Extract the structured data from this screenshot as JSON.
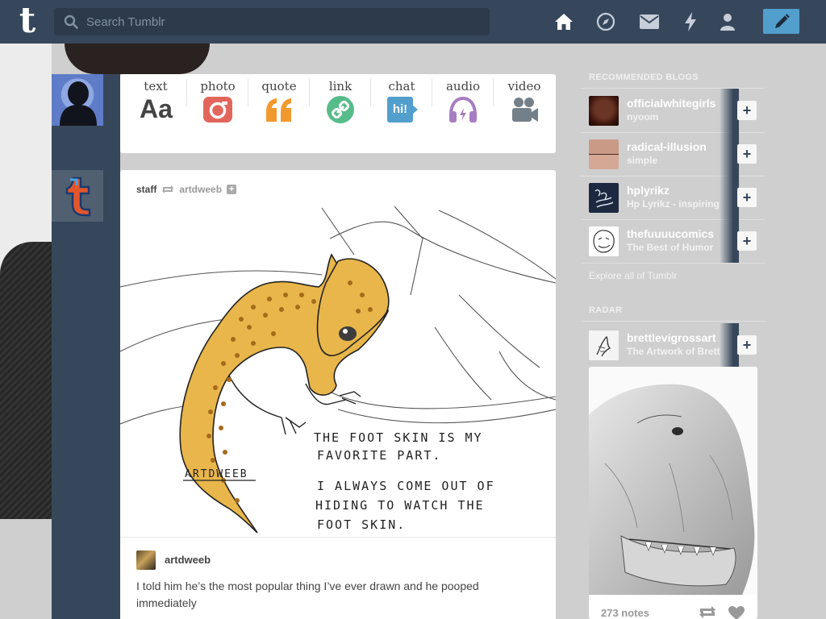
{
  "header": {
    "logo": "t",
    "search_placeholder": "Search Tumblr",
    "icons": [
      "home-icon",
      "explore-compass-icon",
      "inbox-mail-icon",
      "activity-bolt-icon",
      "account-person-icon"
    ],
    "compose_icon": "pencil-icon",
    "colors": {
      "bar": "#37475b",
      "compose": "#529ecc"
    }
  },
  "post_types": [
    {
      "label": "text",
      "icon": "text-aa-icon",
      "glyph": "Aa"
    },
    {
      "label": "photo",
      "icon": "camera-icon"
    },
    {
      "label": "quote",
      "icon": "quote-marks-icon"
    },
    {
      "label": "link",
      "icon": "link-chain-icon"
    },
    {
      "label": "chat",
      "icon": "chat-bubble-icon",
      "glyph": "hi!"
    },
    {
      "label": "audio",
      "icon": "headphones-icon"
    },
    {
      "label": "video",
      "icon": "video-camera-icon"
    }
  ],
  "post": {
    "author": "staff",
    "reblogged_from": "artdweeb",
    "image_text": {
      "signature": "ARTDWEEB",
      "lines": [
        "THE FOOT SKIN IS MY",
        "FAVORITE PART.",
        "I ALWAYS COME OUT OF",
        "HIDING TO WATCH THE",
        "FOOT SKIN."
      ]
    },
    "reblog_blog": "artdweeb",
    "caption": "I told him he’s the most popular thing I’ve ever drawn and he pooped immediately"
  },
  "sidebar": {
    "recommended_title": "RECOMMENDED BLOGS",
    "recommended": [
      {
        "name": "officialwhitegirls",
        "subtitle": "nyoom"
      },
      {
        "name": "radical-illusion",
        "subtitle": "simple"
      },
      {
        "name": "hplyrikz",
        "subtitle": "Hp Lyrikz - inspiring"
      },
      {
        "name": "thefuuuucomics",
        "subtitle": "The Best of Humor"
      }
    ],
    "follow_symbol": "+",
    "explore_label": "Explore all of Tumblr",
    "radar_title": "RADAR",
    "radar": {
      "name": "brettlevigrossart",
      "subtitle": "The Artwork of Brett",
      "notes": "273 notes"
    }
  }
}
